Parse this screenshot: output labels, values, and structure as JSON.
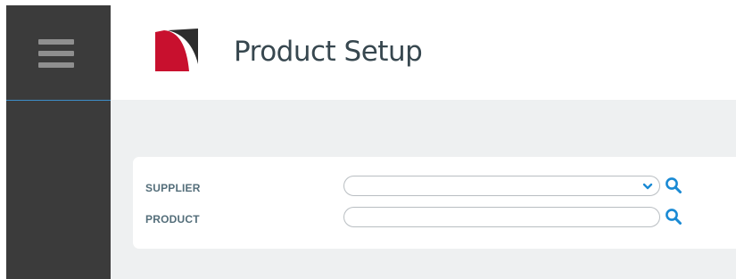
{
  "header": {
    "title": "Product Setup"
  },
  "sidebar": {
    "menu_icon": "hamburger-menu-icon"
  },
  "form": {
    "supplier": {
      "label": "SUPPLIER",
      "value": "",
      "icon": "chevron-down-icon",
      "search_icon": "search-icon"
    },
    "product": {
      "label": "PRODUCT",
      "value": "",
      "search_icon": "search-icon"
    }
  },
  "colors": {
    "sidebar": "#3b3b3b",
    "accent": "#1a8ad4",
    "logo_red": "#c8102e",
    "logo_dark": "#2d2d2d",
    "content_bg": "#eef0f1",
    "separator": "#3d8ec9"
  }
}
